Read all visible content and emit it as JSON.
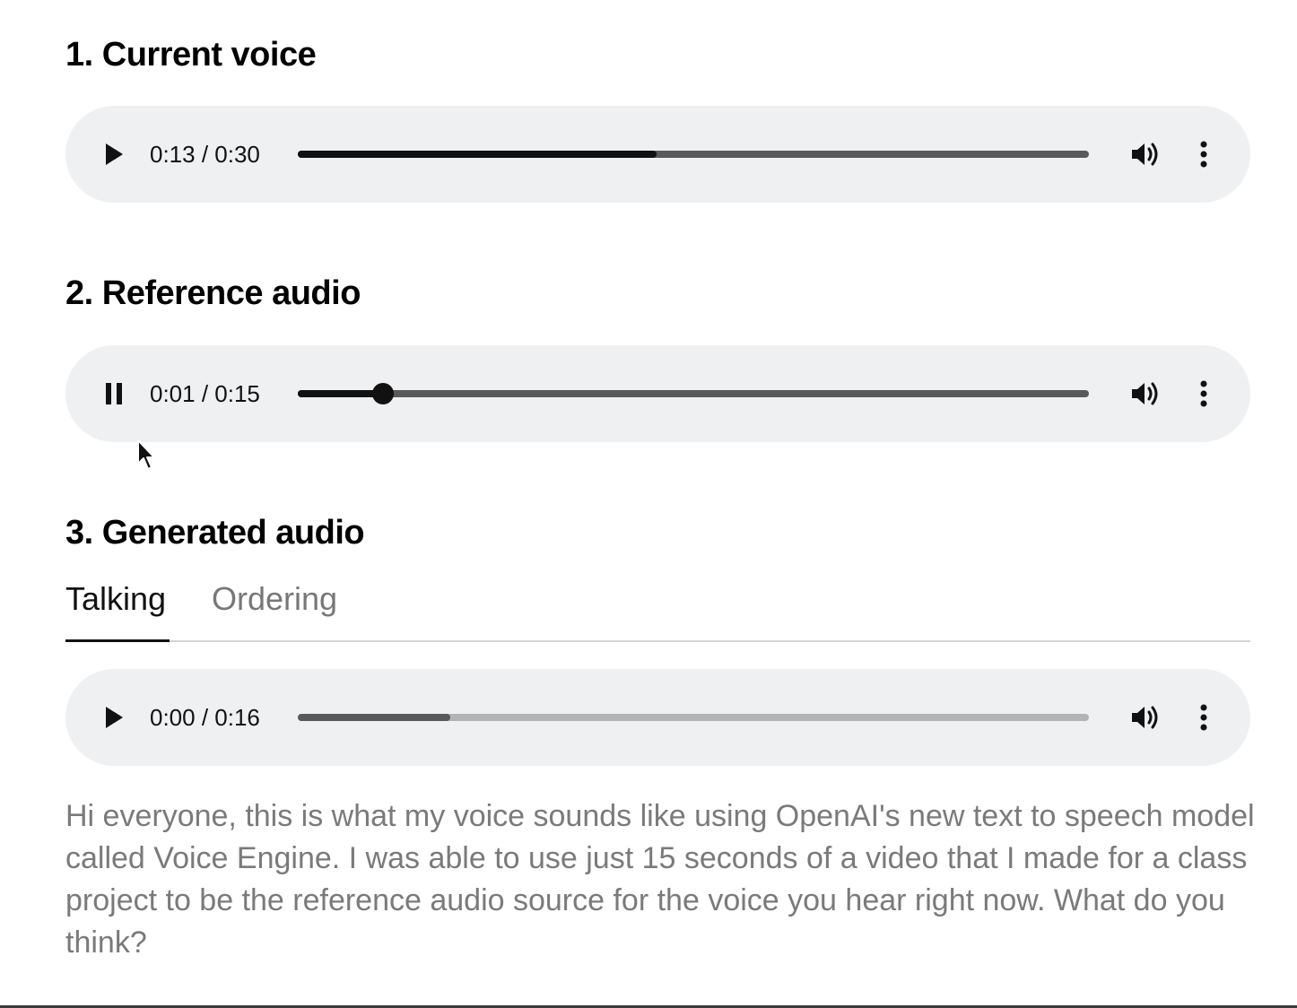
{
  "sections": {
    "current_voice": {
      "title": "1. Current voice",
      "player": {
        "time": "0:13 / 0:30",
        "state": "paused",
        "progress": 0.453,
        "buffered": 1.0,
        "play_icon": "play-icon"
      }
    },
    "reference_audio": {
      "title": "2. Reference audio",
      "player": {
        "time": "0:01 / 0:15",
        "state": "playing",
        "progress": 0.108,
        "buffered": 1.0,
        "play_icon": "pause-icon"
      }
    },
    "generated_audio": {
      "title": "3. Generated audio",
      "tabs": [
        {
          "label": "Talking",
          "active": true
        },
        {
          "label": "Ordering",
          "active": false
        }
      ],
      "player": {
        "time": "0:00 / 0:16",
        "state": "paused",
        "progress": 0.0,
        "buffered": 0.193,
        "play_icon": "play-icon"
      },
      "transcript": "Hi everyone, this is what my voice sounds like using OpenAI's new text to speech model called Voice Engine. I was able to use just 15 seconds of a video that I made for a class project to be the reference audio source for the voice you hear right now. What do you think?"
    }
  },
  "icons": {
    "volume": "volume-icon",
    "more": "more-options-icon",
    "cursor": "mouse-cursor-icon"
  },
  "colors": {
    "player_background": "#eff0f2",
    "track_played": "#111111",
    "track_buffered": "#595959",
    "track_unbuffered": "#b3b3b3",
    "transcript_text": "#7a7a7a",
    "tab_inactive": "#777777"
  }
}
